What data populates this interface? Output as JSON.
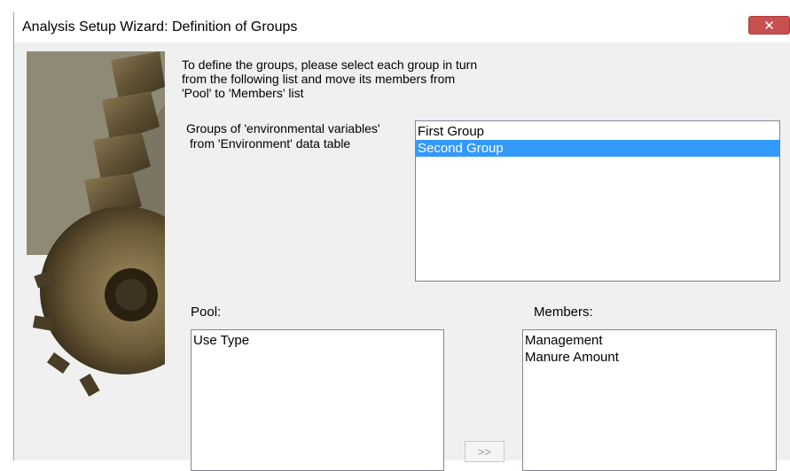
{
  "window": {
    "title": "Analysis Setup Wizard: Definition of Groups",
    "close_glyph": "✕"
  },
  "instructions": {
    "line1": "To define the groups, please select each group in turn",
    "line2": "from the following list and move its members from",
    "line3": "'Pool' to 'Members' list"
  },
  "groups": {
    "label_line1": "Groups of 'environmental variables'",
    "label_line2": "from 'Environment' data table",
    "items": [
      "First Group",
      "Second Group"
    ],
    "selected_index": 1
  },
  "pool": {
    "label": "Pool:",
    "items": [
      "Use Type"
    ]
  },
  "members": {
    "label": "Members:",
    "items": [
      "Management",
      "Manure Amount"
    ]
  },
  "move_button": {
    "label": ">>"
  },
  "colors": {
    "selection": "#3399ff",
    "close_button": "#c75050",
    "window_bg": "#f0f0f0"
  }
}
